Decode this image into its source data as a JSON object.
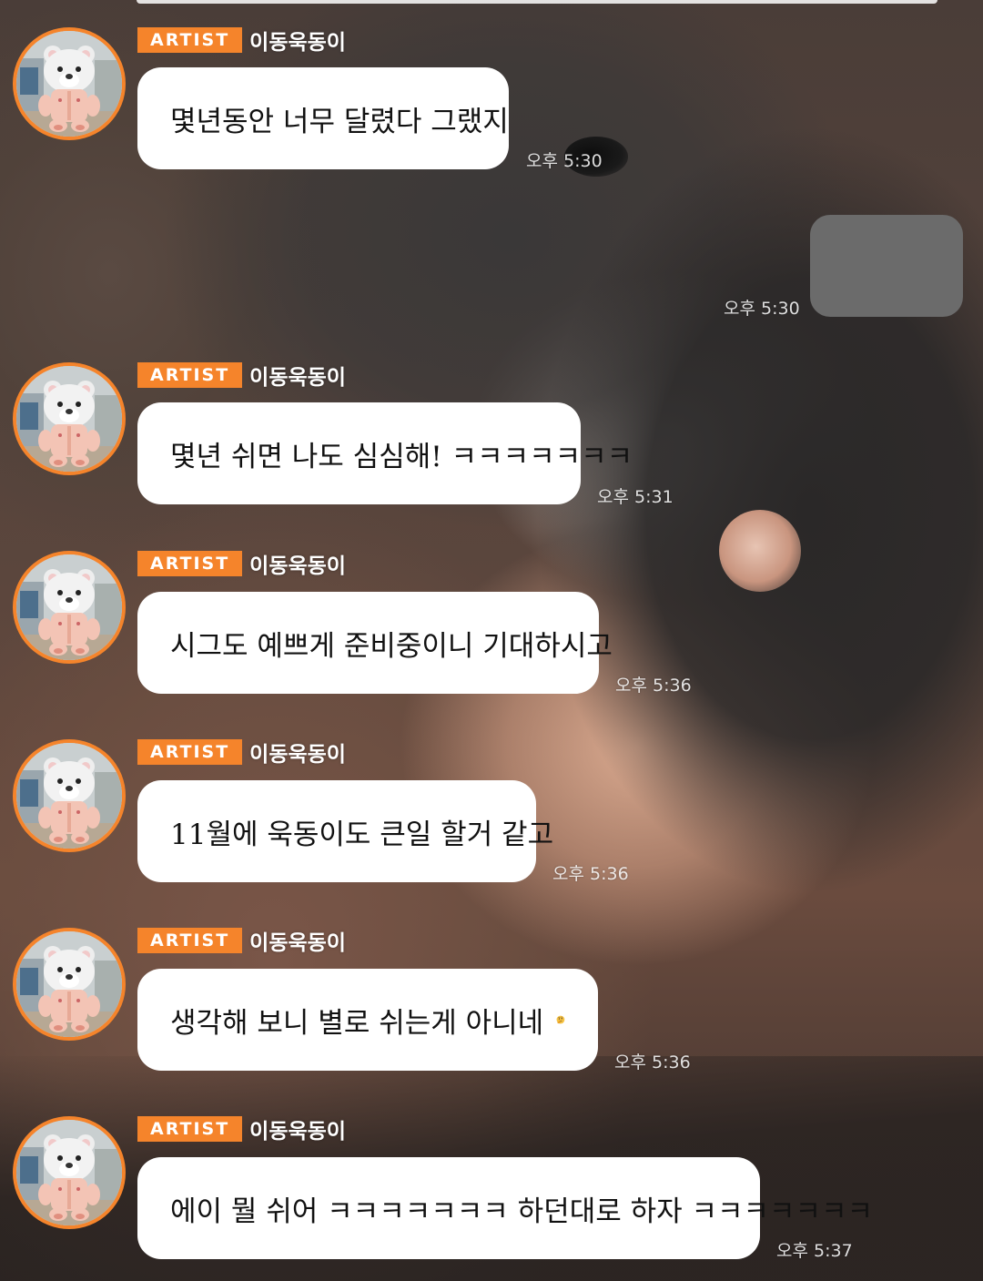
{
  "badge_label": "ARTIST",
  "sender_name": "이동욱동이",
  "messages": [
    {
      "text": "몇년동안 너무 달렸다 그랬지",
      "time": "오후 5:30"
    },
    {
      "text": "몇년 쉬면 나도 심심해! ㅋㅋㅋㅋㅋㅋㅋ",
      "time": "오후 5:31"
    },
    {
      "text": "시그도 예쁘게 준비중이니 기대하시고",
      "time": "오후 5:36"
    },
    {
      "text": "11월에 욱동이도 큰일 할거 같고",
      "time": "오후 5:36"
    },
    {
      "text": "생각해 보니 별로 쉬는게 아니네",
      "emoji": "thinking-face-icon",
      "time": "오후 5:36"
    },
    {
      "text": "에이 뭘 쉬어 ㅋㅋㅋㅋㅋㅋㅋ 하던대로 하자 ㅋㅋㅋㅋㅋㅋㅋ",
      "time": "오후 5:37"
    }
  ],
  "sent_message": {
    "text": "",
    "time": "오후 5:30"
  },
  "colors": {
    "accent": "#f5842b",
    "bubble": "#ffffff",
    "sent_bubble": "#6b6b6b",
    "text": "#111111"
  }
}
